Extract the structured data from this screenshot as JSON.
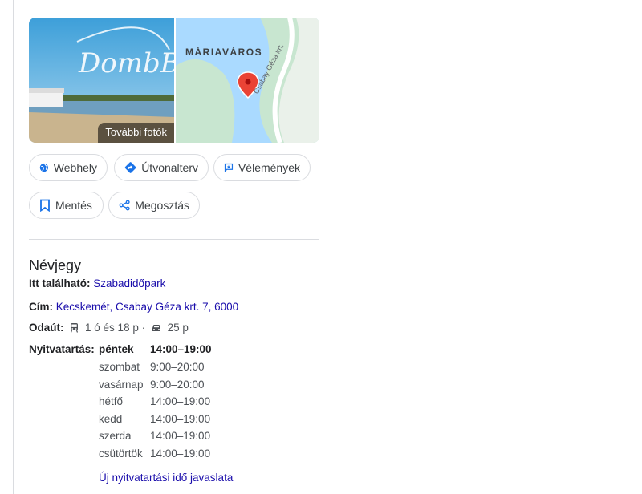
{
  "photos": {
    "more_label": "További fotók",
    "watermark": "DombB"
  },
  "map": {
    "district": "MÁRIAVÁROS",
    "street": "Csabay Géza krt."
  },
  "actions": {
    "website": "Webhely",
    "route": "Útvonalterv",
    "reviews": "Vélemények",
    "save": "Mentés",
    "share": "Megosztás"
  },
  "about": {
    "title": "Névjegy",
    "located_label": "Itt található:",
    "located_value": "Szabadidőpark",
    "address_label": "Cím:",
    "address_value": "Kecskemét, Csabay Géza krt. 7, 6000",
    "route_label": "Odaút:",
    "transit_time": "1 ó és 18 p",
    "separator": "·",
    "car_time": "25 p"
  },
  "hours": {
    "label": "Nyitvatartás:",
    "days": [
      {
        "day": "péntek",
        "time": "14:00–19:00"
      },
      {
        "day": "szombat",
        "time": "9:00–20:00"
      },
      {
        "day": "vasárnap",
        "time": "9:00–20:00"
      },
      {
        "day": "hétfő",
        "time": "14:00–19:00"
      },
      {
        "day": "kedd",
        "time": "14:00–19:00"
      },
      {
        "day": "szerda",
        "time": "14:00–19:00"
      },
      {
        "day": "csütörtök",
        "time": "14:00–19:00"
      }
    ],
    "suggest": "Új nyitvatartási idő javaslata"
  },
  "colors": {
    "link": "#1a0dab",
    "icon_blue": "#1a73e8",
    "pin": "#ea4335",
    "map_water": "#aadaff",
    "map_land": "#c8e6d0"
  }
}
